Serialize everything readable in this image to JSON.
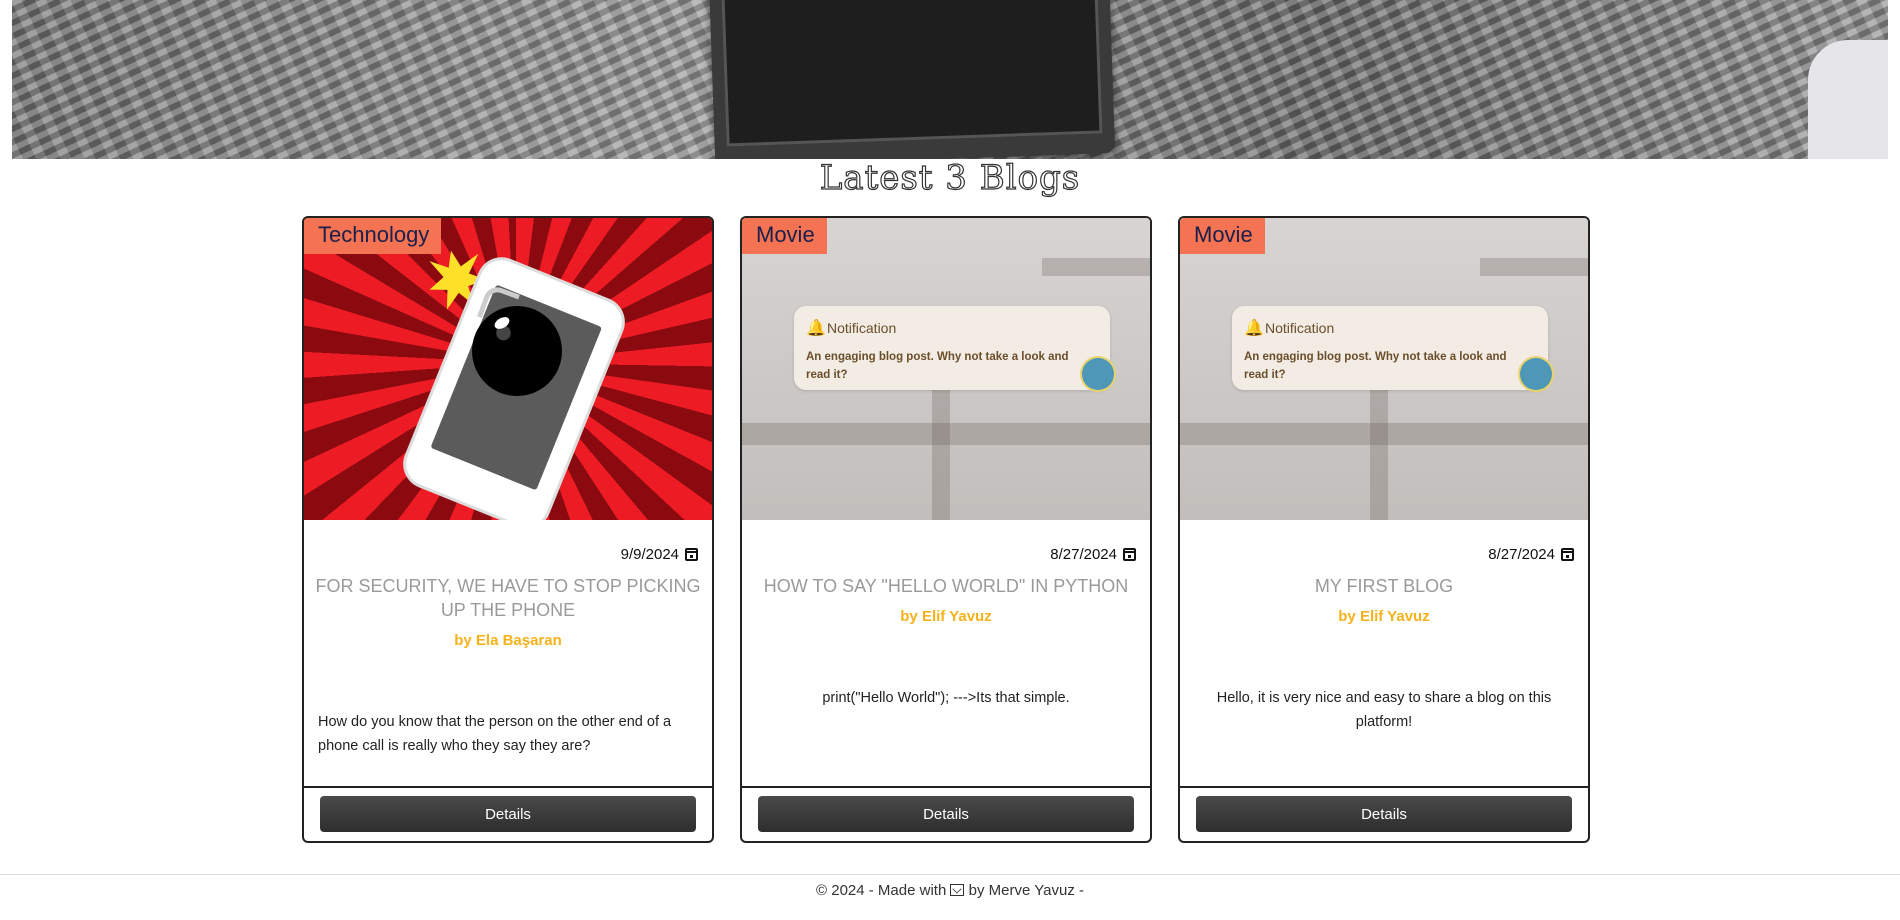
{
  "page": {
    "section_title": "Latest 3 Blogs"
  },
  "posts": [
    {
      "category": "Technology",
      "date": "9/9/2024",
      "title": "FOR SECURITY, WE HAVE TO STOP PICKING UP THE PHONE",
      "author_prefix": "by",
      "author": "Ela Başaran",
      "excerpt": "How do you know that the person on the other end of a phone call is really who they say they are?",
      "details_label": "Details",
      "image_icon": "bomb-phone-illustration"
    },
    {
      "category": "Movie",
      "date": "8/27/2024",
      "title": "HOW TO SAY \"HELLO WORLD\" IN PYTHON",
      "author_prefix": "by",
      "author": "Elif Yavuz",
      "excerpt": "print(\"Hello World\"); --->Its that simple.",
      "details_label": "Details",
      "image_notification": {
        "title": "Notification",
        "body": "An engaging blog post. Why not take a look and read it?"
      }
    },
    {
      "category": "Movie",
      "date": "8/27/2024",
      "title": "MY FIRST BLOG",
      "author_prefix": "by",
      "author": "Elif Yavuz",
      "excerpt": "Hello, it is very nice and easy to share a blog on this platform!",
      "details_label": "Details",
      "image_notification": {
        "title": "Notification",
        "body": "An engaging blog post. Why not take a look and read it?"
      }
    }
  ],
  "footer": {
    "text_before": "© 2024 - Made with",
    "text_after": "by Merve Yavuz -",
    "icon": "mail-icon"
  },
  "colors": {
    "category_tag_bg": "#f47352",
    "category_tag_text": "#1b1f4b",
    "author": "#f6b21a",
    "button_bg": "#3a3a3a"
  }
}
